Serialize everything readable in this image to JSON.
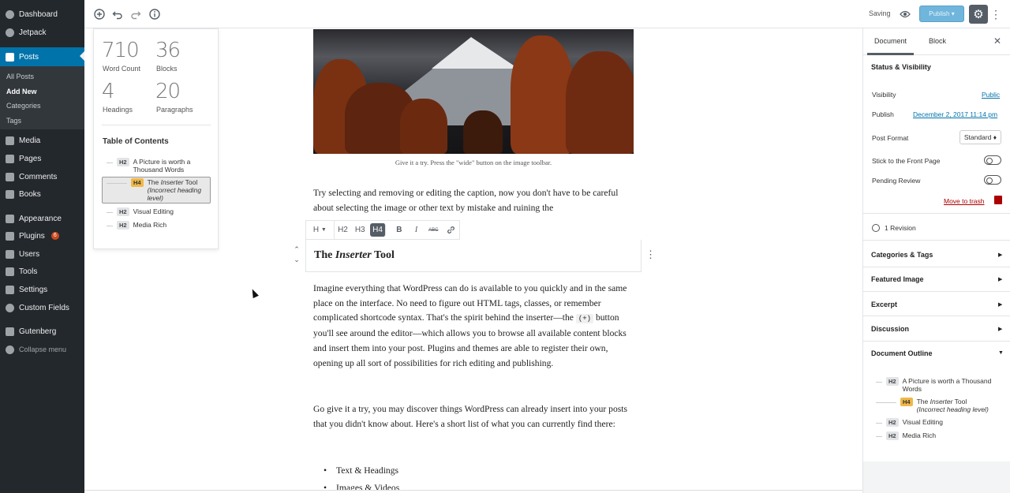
{
  "sidebar": {
    "items": [
      {
        "label": "Dashboard",
        "icon": "dashboard-icon"
      },
      {
        "label": "Jetpack",
        "icon": "jetpack-icon"
      },
      {
        "label": "Posts",
        "icon": "pin-icon"
      },
      {
        "label": "Media",
        "icon": "media-icon"
      },
      {
        "label": "Pages",
        "icon": "pages-icon"
      },
      {
        "label": "Comments",
        "icon": "comments-icon"
      },
      {
        "label": "Books",
        "icon": "books-icon"
      },
      {
        "label": "Appearance",
        "icon": "appearance-icon"
      },
      {
        "label": "Plugins",
        "icon": "plugins-icon",
        "badge": "6"
      },
      {
        "label": "Users",
        "icon": "users-icon"
      },
      {
        "label": "Tools",
        "icon": "tools-icon"
      },
      {
        "label": "Settings",
        "icon": "settings-icon"
      },
      {
        "label": "Custom Fields",
        "icon": "custom-fields-icon"
      },
      {
        "label": "Gutenberg",
        "icon": "gutenberg-icon"
      },
      {
        "label": "Collapse menu",
        "icon": "collapse-icon"
      }
    ],
    "submenu": [
      "All Posts",
      "Add New",
      "Categories",
      "Tags"
    ],
    "accent": "#0073aa"
  },
  "topbar": {
    "icons": [
      "add-block-icon",
      "undo-icon",
      "redo-icon",
      "info-icon"
    ],
    "saving": "Saving",
    "publish": "Publish ▾"
  },
  "info": {
    "word_count": "710",
    "word_count_label": "Word Count",
    "blocks": "36",
    "blocks_label": "Blocks",
    "headings": "4",
    "headings_label": "Headings",
    "paragraphs": "20",
    "paragraphs_label": "Paragraphs",
    "toc_title": "Table of Contents",
    "toc": [
      {
        "level": "H2",
        "text": "A Picture is worth a Thousand Words"
      },
      {
        "level": "H4",
        "text_a": "The ",
        "text_b": "Inserter",
        "text_c": " Tool",
        "note": "(Incorrect heading level)"
      },
      {
        "level": "H2",
        "text": "Visual Editing"
      },
      {
        "level": "H2",
        "text": "Media Rich"
      }
    ]
  },
  "editor": {
    "caption": "Give it a try. Press the \"wide\" button on the image toolbar.",
    "para1": "Try selecting and removing or editing the caption, now you don't have to be careful about selecting the image or other text by mistake and ruining the",
    "toolbar": {
      "h": "H",
      "h2": "H2",
      "h3": "H3",
      "h4": "H4",
      "bold": "B",
      "italic": "I",
      "strike": "ABC"
    },
    "heading_a": "The ",
    "heading_b": "Inserter",
    "heading_c": " Tool",
    "para2_a": "Imagine everything that WordPress can do is available to you quickly and in the same place on the interface. No need to figure out HTML tags, classes, or remember complicated shortcode syntax. That's the spirit behind the inserter—the ",
    "para2_code": "(+)",
    "para2_b": " button you'll see around the editor—which allows you to browse all available content blocks and insert them into your post. Plugins and themes are able to register their own, opening up all sort of possibilities for rich editing and publishing.",
    "para3": "Go give it a try, you may discover things WordPress can already insert into your posts that you didn't know about. Here's a short list of what you can currently find there:",
    "list": [
      "Text & Headings",
      "Images & Videos"
    ]
  },
  "settings": {
    "tab_document": "Document",
    "tab_block": "Block",
    "status_title": "Status & Visibility",
    "visibility_label": "Visibility",
    "visibility_value": "Public",
    "publish_label": "Publish",
    "publish_value": "December 2, 2017 11:14 pm",
    "format_label": "Post Format",
    "format_value": "Standard ♦",
    "sticky_label": "Stick to the Front Page",
    "pending_label": "Pending Review",
    "trash": "Move to trash",
    "revision": "1 Revision",
    "panels": [
      "Categories & Tags",
      "Featured Image",
      "Excerpt",
      "Discussion",
      "Document Outline"
    ],
    "outline": [
      {
        "level": "H2",
        "text": "A Picture is worth a Thousand Words"
      },
      {
        "level": "H4",
        "text_a": "The ",
        "text_b": "Inserter",
        "text_c": " Tool",
        "note": "(Incorrect heading level)"
      },
      {
        "level": "H2",
        "text": "Visual Editing"
      },
      {
        "level": "H2",
        "text": "Media Rich"
      }
    ]
  }
}
